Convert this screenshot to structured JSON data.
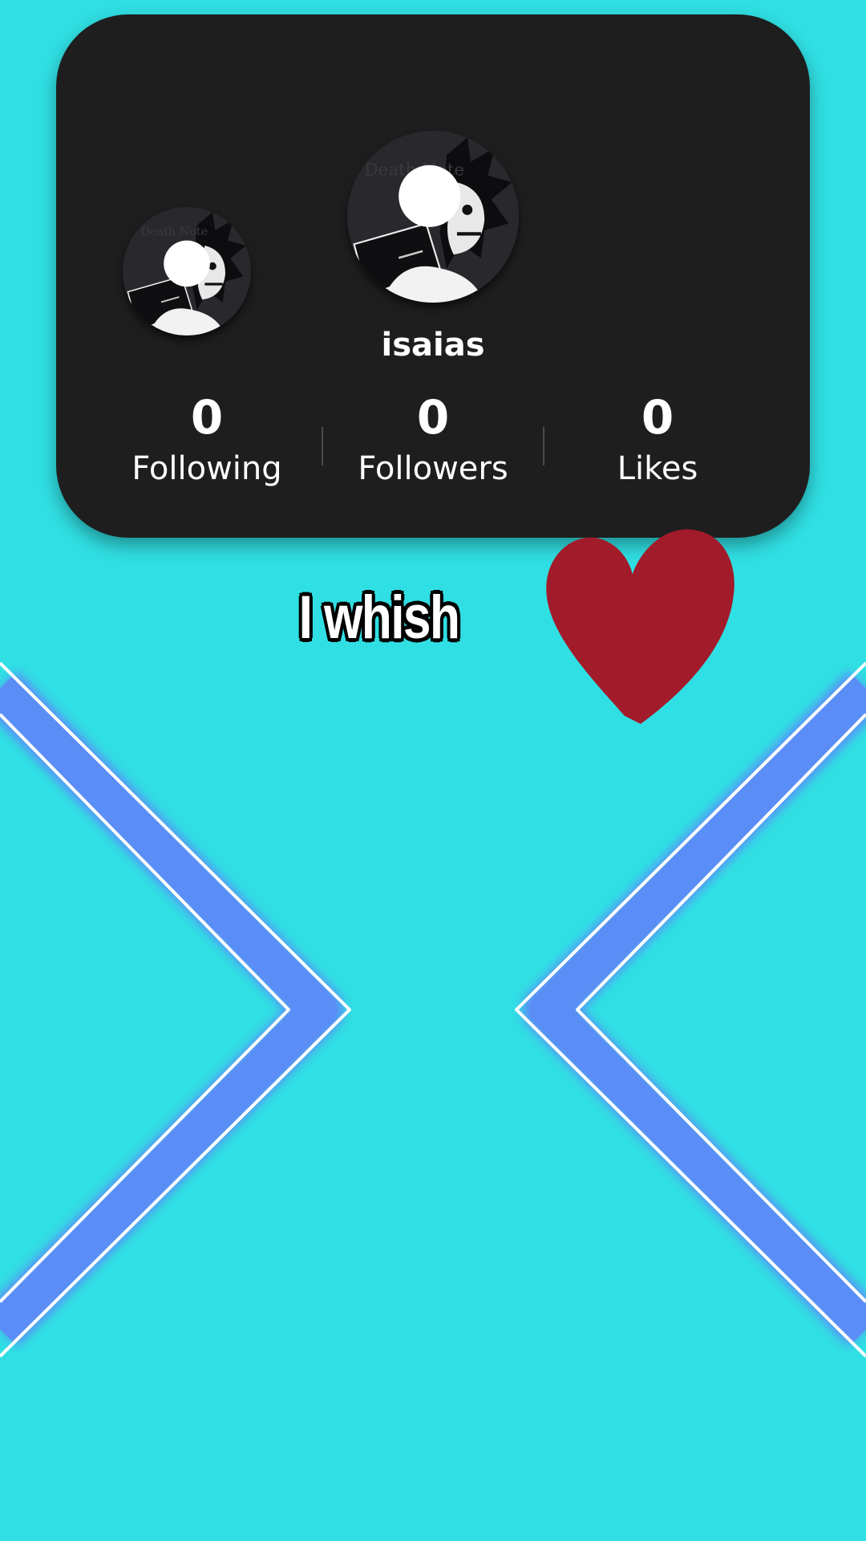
{
  "profile": {
    "username": "isaias",
    "avatar_icon": "death-note-ryuk-avatar-icon",
    "secondary_avatar_icon": "death-note-ryuk-avatar-icon",
    "stats": [
      {
        "value": "0",
        "label": "Following"
      },
      {
        "value": "0",
        "label": "Followers"
      },
      {
        "value": "0",
        "label": "Likes"
      }
    ]
  },
  "overlay": {
    "caption": "I whish",
    "heart_icon": "heart-icon",
    "heart_color": "#a21b2a"
  },
  "background": {
    "color": "#30dfe3",
    "neon_shapes": "chevron-brackets",
    "neon_color": "#5b8df7"
  }
}
